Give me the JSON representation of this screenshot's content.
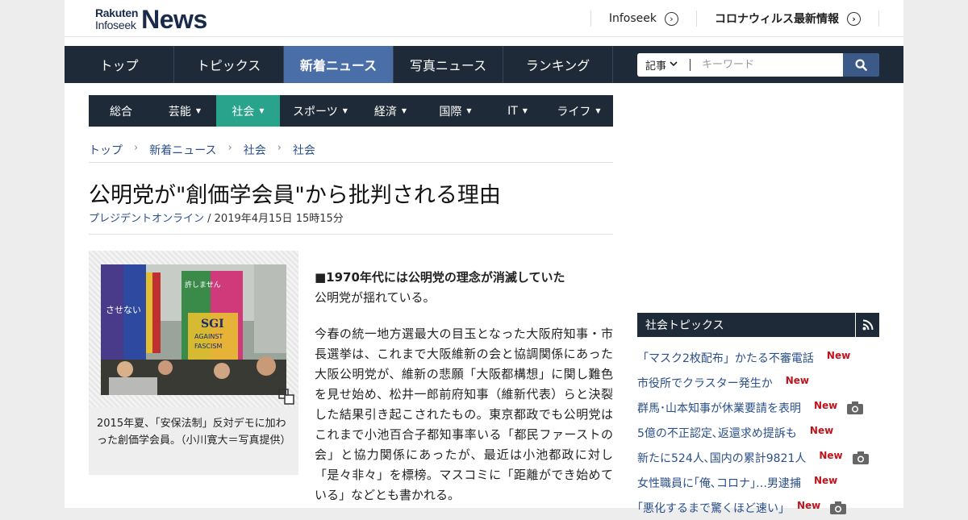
{
  "header": {
    "logo_line1": "Rakuten",
    "logo_line2": "Infoseek",
    "logo_big": "News",
    "links": [
      {
        "label": "Infoseek",
        "icon": "circle-chevron-right-icon"
      },
      {
        "label": "コロナウィルス最新情報",
        "icon": "circle-chevron-right-icon"
      }
    ]
  },
  "nav": {
    "items": [
      "トップ",
      "トピックス",
      "新着ニュース",
      "写真ニュース",
      "ランキング"
    ],
    "active_index": 2
  },
  "search": {
    "select_value": "記事",
    "placeholder": "キーワード",
    "button_icon": "search-icon"
  },
  "subnav": {
    "items": [
      "総合",
      "芸能",
      "社会",
      "スポーツ",
      "経済",
      "国際",
      "IT",
      "ライフ"
    ],
    "active_index": 2
  },
  "breadcrumb": [
    "トップ",
    "新着ニュース",
    "社会",
    "社会"
  ],
  "article": {
    "title": "公明党が\"創価学会員\"から批判される理由",
    "source": "プレジデントオンライン",
    "date": " / 2019年4月15日 15時15分",
    "section_heading": "■1970年代には公明党の理念が消滅していた",
    "lead": "公明党が揺れている。",
    "paragraph": "今春の統一地方選最大の目玉となった大阪府知事・市長選挙は、これまで大阪維新の会と協調関係にあった大阪公明党が、維新の悲願「大阪都構想」に関し難色を見せ始め、松井一郎前府知事（維新代表）らと決裂した結果引き起こされたもの。東京都政でも公明党はこれまで小池百合子都知事率いる「都民ファーストの会」と協力関係にあったが、最近は小池都政に対し「是々非々」を標榜。マスコミに「距離ができ始めている」などとも書かれる。",
    "photo_caption": "2015年夏、「安保法制」反対デモに加わった創価学会員。（小川寛大＝写真提供）",
    "photo_banner_texts": [
      "許しません",
      "SGI",
      "AGAINST",
      "FASCISM",
      "させない"
    ]
  },
  "sidebar": {
    "heading": "社会トピックス",
    "rss_icon": "rss-icon",
    "new_label": "New",
    "topics": [
      {
        "title": "「マスク2枚配布」かたる不審電話",
        "new": true,
        "photo": false
      },
      {
        "title": "市役所でクラスター発生か",
        "new": true,
        "photo": false
      },
      {
        "title": "群馬･山本知事が休業要請を表明",
        "new": true,
        "photo": true
      },
      {
        "title": "5億の不正認定､返還求め提訴も",
        "new": true,
        "photo": false
      },
      {
        "title": "新たに524人､国内の累計9821人",
        "new": true,
        "photo": true
      },
      {
        "title": "女性職員に｢俺､コロナ｣…男逮捕",
        "new": true,
        "photo": false
      },
      {
        "title": "｢悪化するまで驚くほど速い｣",
        "new": true,
        "photo": true
      }
    ]
  },
  "colors": {
    "nav_bg": "#1f2a38",
    "nav_active": "#4a6ea8",
    "subnav_active": "#2aa38c",
    "link": "#2a4f8a",
    "new_badge": "#c0141c"
  }
}
